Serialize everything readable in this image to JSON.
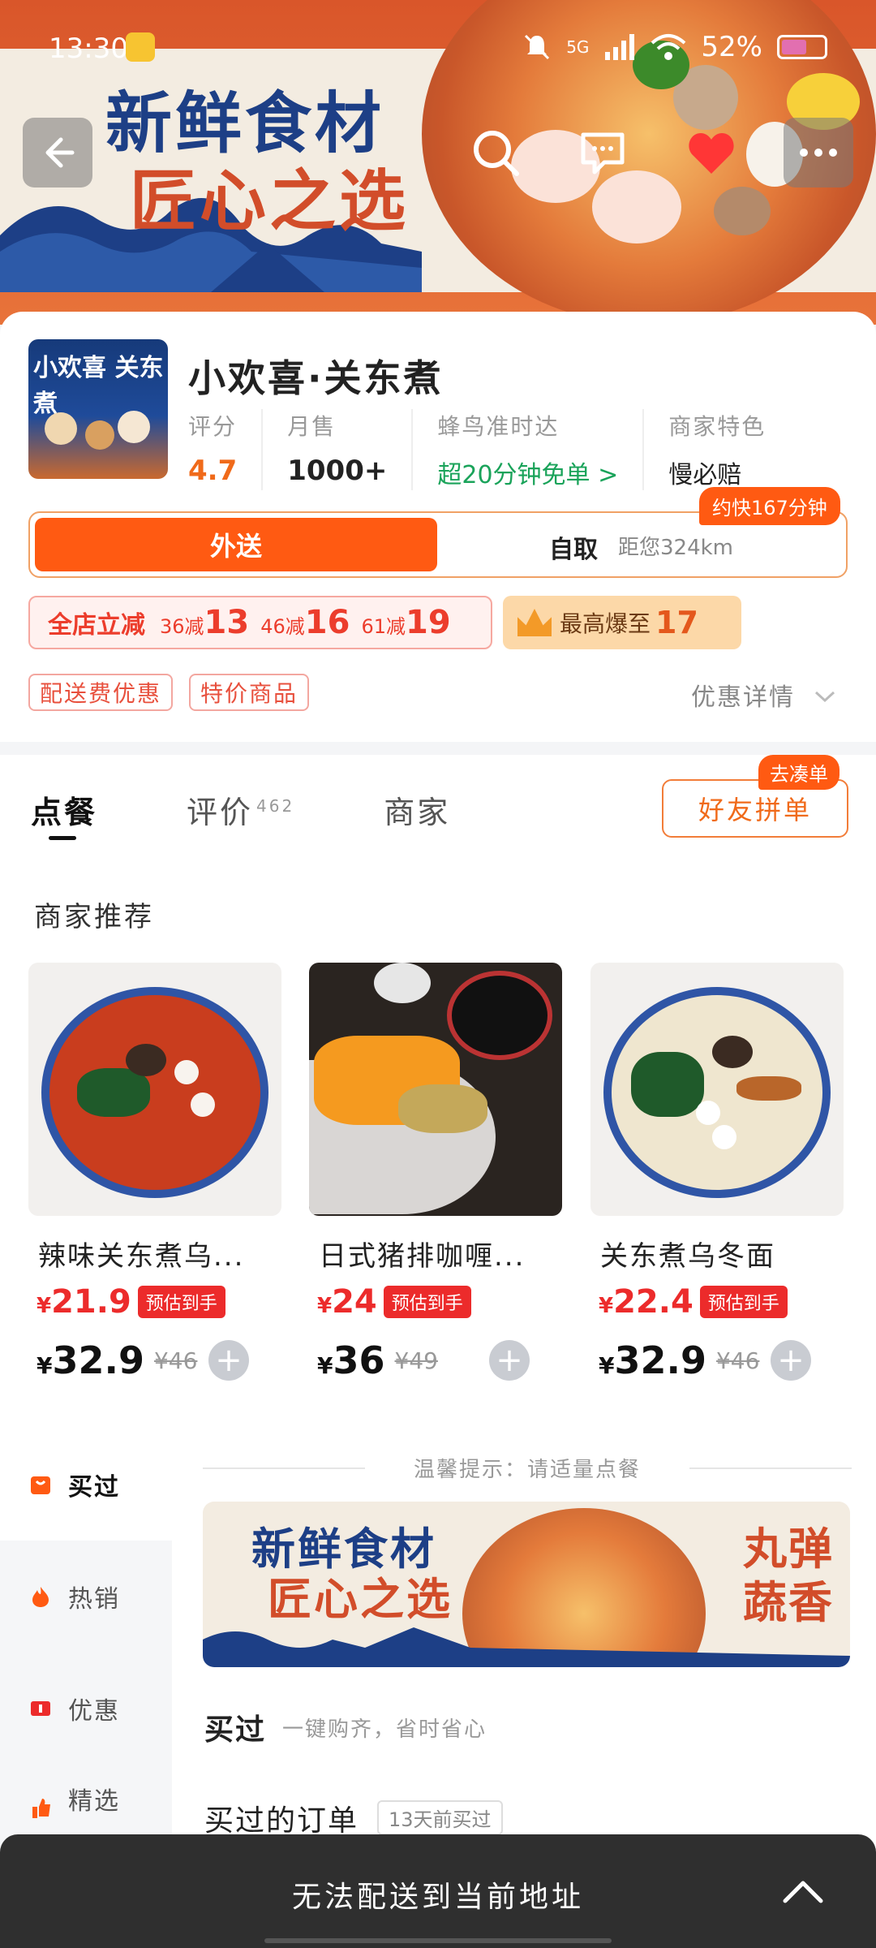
{
  "status_bar": {
    "time": "13:30",
    "network": "5G",
    "battery": "52%"
  },
  "banner": {
    "line1": "新鲜食材",
    "line2": "匠心之选"
  },
  "shop": {
    "name": "小欢喜·关东煮",
    "logo_text": "小欢喜 关东煮",
    "stats": [
      {
        "key": "评分",
        "value": "4.7"
      },
      {
        "key": "月售",
        "value": "1000+"
      },
      {
        "key": "蜂鸟准时达",
        "value": "超20分钟免单 >"
      },
      {
        "key": "商家特色",
        "value": "慢必赔"
      }
    ]
  },
  "mode": {
    "delivery": "外送",
    "pickup": "自取",
    "distance": "距您324km",
    "eta": "约快167分钟"
  },
  "promo": {
    "title": "全店立减",
    "tiers": [
      {
        "cond": "36减",
        "amt": "13"
      },
      {
        "cond": "46减",
        "amt": "16"
      },
      {
        "cond": "61减",
        "amt": "19"
      }
    ],
    "boost_label": "最高爆至",
    "boost_value": "17"
  },
  "tags": [
    "配送费优惠",
    "特价商品"
  ],
  "offer_detail": "优惠详情",
  "tabs": {
    "order": "点餐",
    "review": "评价",
    "review_count": "462",
    "merchant": "商家"
  },
  "friend": {
    "button": "好友拼单",
    "badge": "去凑单"
  },
  "rec_title": "商家推荐",
  "dishes": [
    {
      "name": "辣味关东煮乌...",
      "est": "21.9",
      "est_label": "预估到手",
      "price": "32.9",
      "orig": "¥46"
    },
    {
      "name": "日式猪排咖喱...",
      "est": "24",
      "est_label": "预估到手",
      "price": "36",
      "orig": "¥49"
    },
    {
      "name": "关东煮乌冬面",
      "est": "22.4",
      "est_label": "预估到手",
      "price": "32.9",
      "orig": "¥46"
    }
  ],
  "currency": "¥",
  "sidebar": [
    "买过",
    "热销",
    "优惠",
    "精选"
  ],
  "hint": "温馨提示：请适量点餐",
  "banner2": {
    "line1": "新鲜食材",
    "line2": "匠心之选",
    "right1": "丸弹",
    "right2": "蔬香"
  },
  "bought": {
    "title": "买过",
    "sub": "一键购齐，省时省心"
  },
  "orders": {
    "title": "买过的订单",
    "tag": "13天前买过"
  },
  "bottom_msg": "无法配送到当前地址",
  "colors": {
    "accent": "#ff5a12",
    "price_red": "#ec2b2b",
    "green": "#1aa35a"
  }
}
